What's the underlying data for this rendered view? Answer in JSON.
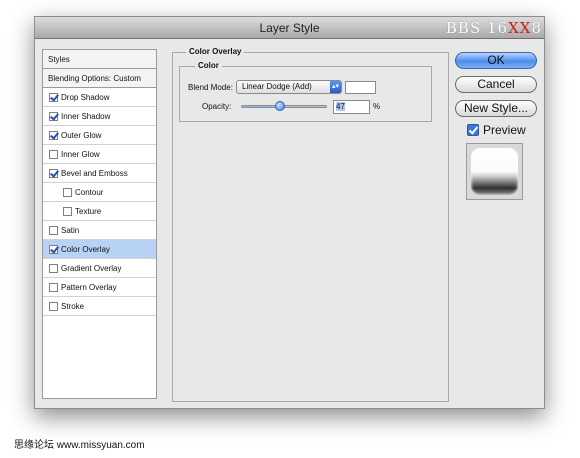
{
  "window": {
    "title": "Layer Style"
  },
  "watermark_top": {
    "part1": "BBS 16",
    "part2": "XX",
    "part3": "8"
  },
  "style_list": {
    "header": "Styles",
    "blending": "Blending Options: Custom",
    "items": [
      {
        "label": "Drop Shadow",
        "checked": true
      },
      {
        "label": "Inner Shadow",
        "checked": true
      },
      {
        "label": "Outer Glow",
        "checked": true
      },
      {
        "label": "Inner Glow",
        "checked": false
      },
      {
        "label": "Bevel and Emboss",
        "checked": true
      },
      {
        "label": "Contour",
        "checked": false
      },
      {
        "label": "Texture",
        "checked": false
      },
      {
        "label": "Satin",
        "checked": false
      },
      {
        "label": "Color Overlay",
        "checked": true,
        "selected": true
      },
      {
        "label": "Gradient Overlay",
        "checked": false
      },
      {
        "label": "Pattern Overlay",
        "checked": false
      },
      {
        "label": "Stroke",
        "checked": false
      }
    ]
  },
  "panel": {
    "title": "Color Overlay",
    "subtitle": "Color",
    "blend_mode_label": "Blend Mode:",
    "blend_mode_value": "Linear Dodge (Add)",
    "overlay_color": "#ffffff",
    "opacity_label": "Opacity:",
    "opacity_value": "47",
    "opacity_unit": "%",
    "opacity_fraction": 0.47
  },
  "buttons": {
    "ok": "OK",
    "cancel": "Cancel",
    "new_style": "New Style..."
  },
  "preview": {
    "label": "Preview",
    "checked": true
  },
  "footer_watermark": "思缘论坛  www.missyuan.com"
}
